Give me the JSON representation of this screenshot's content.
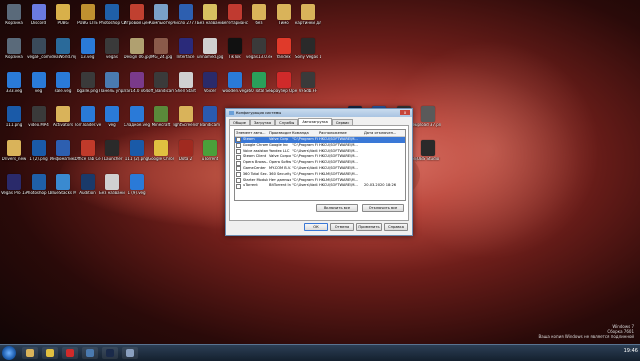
{
  "desktop_icons": [
    {
      "label": "Корзина",
      "color": "#5a6a7a"
    },
    {
      "label": "Discord",
      "color": "#6a7ae0"
    },
    {
      "label": "PUBG",
      "color": "#d8b04a"
    },
    {
      "label": "PUBG LITE",
      "color": "#c09030"
    },
    {
      "label": "Photoshop CS6",
      "color": "#1f5fa8"
    },
    {
      "label": "Игровой центр",
      "color": "#c04030"
    },
    {
      "label": "Компьютер",
      "color": "#7aa0c8"
    },
    {
      "label": "Число 2777.docx",
      "color": "#2d5fb0"
    },
    {
      "label": "Без названия",
      "color": "#d8c060"
    },
    {
      "label": "вегетарианство",
      "color": "#c03a30"
    },
    {
      "label": "без",
      "color": "#d9b35a"
    },
    {
      "label": "Тимо",
      "color": "#d9b35a"
    },
    {
      "label": "картинки для презентаций",
      "color": "#d9b35a"
    },
    {
      "label": "Корзина",
      "color": "#5a6a7a"
    },
    {
      "label": "vegaF_com",
      "color": "#3a4a5a"
    },
    {
      "label": "ideaWorld.mp4",
      "color": "#2a6a9a"
    },
    {
      "label": "13.veg",
      "color": "#2a7ad8"
    },
    {
      "label": "vegas",
      "color": "#3a3a3a"
    },
    {
      "label": "Design 06.jpg",
      "color": "#b0a070"
    },
    {
      "label": "IMG_24.jpg",
      "color": "#8a5a4a"
    },
    {
      "label": "Interface",
      "color": "#2a2a7a"
    },
    {
      "label": "unnamed.jpg",
      "color": "#d0d0d0"
    },
    {
      "label": "TikTok",
      "color": "#111111"
    },
    {
      "label": "vegas13.0.exe",
      "color": "#3a3a3a"
    },
    {
      "label": "Yandex",
      "color": "#e03a2a"
    },
    {
      "label": "Sony Vegas 13",
      "color": "#2a2a2a"
    },
    {
      "label": "333.veg",
      "color": "#2a7ad8"
    },
    {
      "label": "veg",
      "color": "#2a7ad8"
    },
    {
      "label": "sale.veg",
      "color": "#2a7ad8"
    },
    {
      "label": "bgalle.png",
      "color": "#3a3a3a"
    },
    {
      "label": "Панель управления",
      "color": "#4a7ab0"
    },
    {
      "label": "rar14.0 x64",
      "color": "#7a3a8a"
    },
    {
      "label": "off_Bandicam",
      "color": "#3a3a3a"
    },
    {
      "label": "Shell Start",
      "color": "#d0d0d0"
    },
    {
      "label": "Voicer",
      "color": "#2a2a6a"
    },
    {
      "label": "wooden.veg",
      "color": "#2a7ad8"
    },
    {
      "label": "360 Total Security",
      "color": "#2aa05a"
    },
    {
      "label": "Браузер Opera",
      "color": "#d02a2a"
    },
    {
      "label": "VFSdb.FF",
      "color": "#3a3a3a"
    },
    {
      "label": "111.png",
      "color": "#1a5aa8"
    },
    {
      "label": "video.MP4",
      "color": "#3a3a3a"
    },
    {
      "label": "Activators",
      "color": "#d9b35a"
    },
    {
      "label": "Torr.loader.veg",
      "color": "#2a7ad8"
    },
    {
      "label": "veg",
      "color": "#2a7ad8"
    },
    {
      "label": "Сладкое.veg",
      "color": "#2a7ad8"
    },
    {
      "label": "Minecraft",
      "color": "#5a8a3a"
    },
    {
      "label": "lightScreenshot",
      "color": "#d9b35a"
    },
    {
      "label": "Bandicam",
      "color": "#2a5ab0"
    },
    {
      "label": "Steam",
      "color": "#1a2a4a"
    },
    {
      "label": "Бэкд 37.docx",
      "color": "#2d5fb0"
    },
    {
      "label": "Клиент Ивентор",
      "color": "#3a3a3a"
    },
    {
      "label": "upload 37.png",
      "color": "#5a5a5a"
    },
    {
      "label": "Drivers_new",
      "color": "#d9b35a"
    },
    {
      "label": "1 (2).png",
      "color": "#1a5aa8"
    },
    {
      "label": "Инфоматика блок.docx",
      "color": "#2d5fb0"
    },
    {
      "label": "Office Tab Center",
      "color": "#c03a2a"
    },
    {
      "label": "TLauncher",
      "color": "#2a2a2a"
    },
    {
      "label": "111 (2).png",
      "color": "#1a5aa8"
    },
    {
      "label": "Google Chrome",
      "color": "#e0c040"
    },
    {
      "label": "Dota 2",
      "color": "#a02a20"
    },
    {
      "label": "uTorrent",
      "color": "#4aa03a"
    },
    {
      "label": "BlueStacks",
      "color": "#5ab03a"
    },
    {
      "label": "7568356.png",
      "color": "#3a3a3a"
    },
    {
      "label": "stroka (1).png",
      "color": "#1a5aa8"
    },
    {
      "label": "OBS Studio",
      "color": "#2a2a2a"
    },
    {
      "label": "Vegas Pro 13.0 (64-bit)",
      "color": "#2a2a6a"
    },
    {
      "label": "Photoshop CS6 (64 Bit)",
      "color": "#1f5fa8"
    },
    {
      "label": "BlueStacks Multi-Insta...",
      "color": "#3a8ad0"
    },
    {
      "label": "Audition",
      "color": "#1a3a6a"
    },
    {
      "label": "Без названия",
      "color": "#d0d0d0"
    },
    {
      "label": "1 (9).veg",
      "color": "#2a7ad8"
    }
  ],
  "dialog": {
    "title": "Конфигурация системы",
    "close": "x",
    "tabs": [
      "Общие",
      "Загрузка",
      "Службы",
      "Автозагрузка",
      "Сервис"
    ],
    "active_tab": "Автозагрузка",
    "columns": [
      "Элемент авто...",
      "Производитель",
      "Команда",
      "Расположение",
      "Дата отключен..."
    ],
    "rows": [
      [
        "Steam",
        "Valve Corp",
        "\"C:\\Program Fi...",
        "HKCU\\SOFTWARE\\M...",
        ""
      ],
      [
        "Google Chrome",
        "Google Inc",
        "\"C:\\Program Fi...",
        "HKCU\\SOFTWARE\\M...",
        ""
      ],
      [
        "Voice assistant",
        "Yandex LLC",
        "\"C:\\Users\\Vadi...",
        "HKCU\\SOFTWARE\\M...",
        ""
      ],
      [
        "Steam Client",
        "Valve Corporat...",
        "\"C:\\Program Fi...",
        "HKCU\\SOFTWARE\\M...",
        ""
      ],
      [
        "Opera Brows...",
        "Opera Software",
        "\"C:\\Program Fi...",
        "HKCU\\SOFTWARE\\M...",
        ""
      ],
      [
        "GameCenter",
        "MY.COM B.V.",
        "\"C:\\Users\\Vadi...",
        "HKCU\\SOFTWARE\\M...",
        ""
      ],
      [
        "360 Total Sec...",
        "360 Security...",
        "\"C:\\Program Fi...",
        "HKLM\\SOFTWARE\\M...",
        ""
      ],
      [
        "Starter Module",
        "Нет данных",
        "\"C:\\Program Fi...",
        "HKLM\\SOFTWARE\\M...",
        ""
      ],
      [
        "uTorrent",
        "BitTorrent Inc.",
        "\"C:\\Users\\Vadi...",
        "HKCU\\SOFTWARE\\M...",
        "20.03.2020 18:26"
      ]
    ],
    "enable_all": "Включить все",
    "disable_all": "Отключить все",
    "ok": "ОК",
    "cancel": "Отмена",
    "apply": "Применить",
    "help": "Справка"
  },
  "watermark": {
    "line1": "Windows 7",
    "line2": "Сборка 7601",
    "line3": "Ваша копия Windows не является подлинной"
  },
  "taskbar": {
    "clock": "19:46",
    "apps": [
      {
        "name": "explorer",
        "color": "#d9b35a"
      },
      {
        "name": "chrome",
        "color": "#e0c040"
      },
      {
        "name": "opera",
        "color": "#d02a2a"
      },
      {
        "name": "media",
        "color": "#4a7ab0"
      },
      {
        "name": "steam",
        "color": "#1a2a4a"
      },
      {
        "name": "msconfig",
        "color": "#8aa0c0"
      }
    ]
  }
}
